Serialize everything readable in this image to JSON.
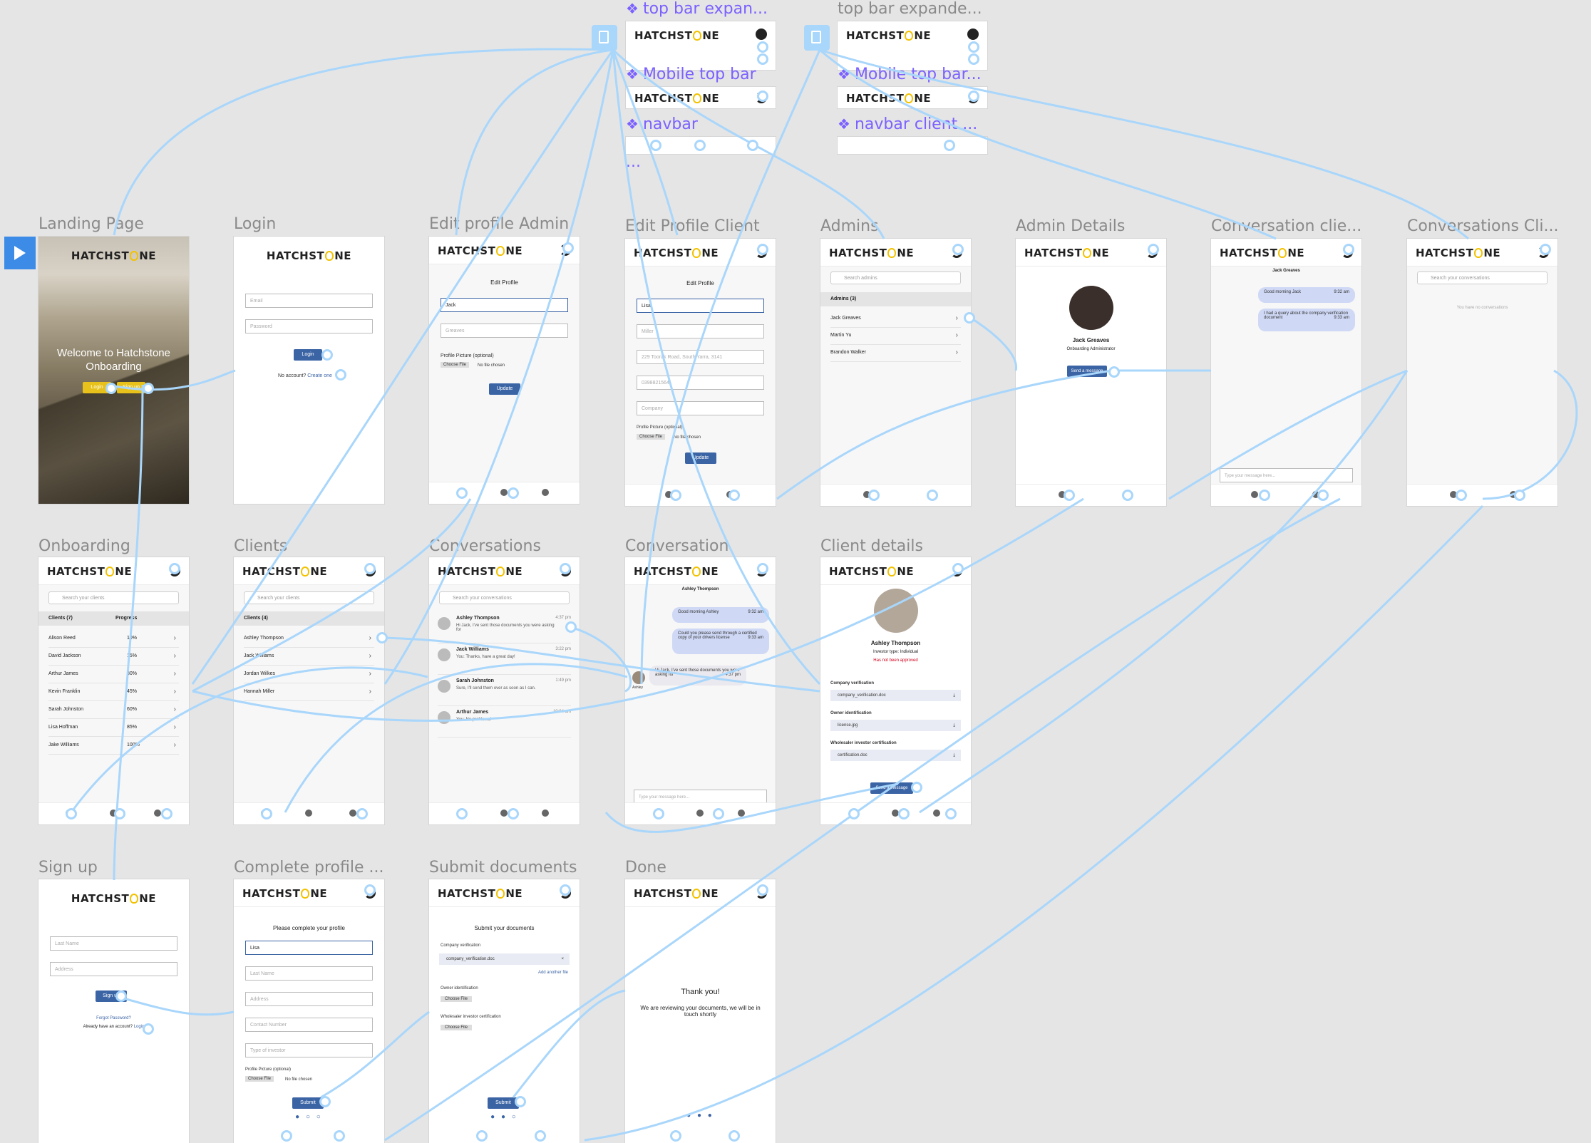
{
  "brand": {
    "logo_text_before": "HATCHST",
    "logo_text_after": "NE",
    "accent": "#3b64a5",
    "logo_yellow": "#f2c200",
    "connector": "#a9d6fb",
    "component_purple": "#7b61ff"
  },
  "components": {
    "top_bar_expanded_1": "top bar expan...",
    "top_bar_expanded_2": "top bar expande...",
    "mobile_top_bar_1": "Mobile top bar",
    "mobile_top_bar_2": "Mobile top bar...",
    "navbar": "navbar",
    "navbar_client": "navbar client ...",
    "more": "..."
  },
  "frames": {
    "landing": {
      "label": "Landing Page",
      "welcome": "Welcome to Hatchstone Onboarding",
      "login_btn": "Login",
      "signup_btn": "Sign up"
    },
    "login": {
      "label": "Login",
      "email_ph": "Email",
      "password_ph": "Password",
      "submit": "Login",
      "no_account": "No account?",
      "create": "Create one"
    },
    "edit_profile_admin": {
      "label": "Edit profile Admin",
      "heading": "Edit Profile",
      "first": "Jack",
      "last": "Greaves",
      "pic_label": "Profile Picture (optional)",
      "choose": "Choose File",
      "no_file": "No file chosen",
      "update": "Update"
    },
    "edit_profile_client": {
      "label": "Edit Profile Client",
      "heading": "Edit Profile",
      "first": "Lisa",
      "last": "Miller",
      "address": "229 Toorak Road, South Yarra, 3141",
      "phone": "0398821564",
      "type": "Company",
      "pic_label": "Profile Picture (optional)",
      "choose": "Choose File",
      "no_file": "No file chosen",
      "update": "Update"
    },
    "admins": {
      "label": "Admins",
      "search_ph": "Search admins",
      "section": "Admins (3)",
      "rows": [
        "Jack Greaves",
        "Martin Yu",
        "Brandon Walker"
      ]
    },
    "admin_details": {
      "label": "Admin Details",
      "name": "Jack Greaves",
      "role": "Onboarding Administrator",
      "send": "Send a message"
    },
    "conversation_client": {
      "label": "Conversation clie...",
      "with": "Jack Greaves",
      "b1": "Good morning Jack",
      "b1_time": "9:32 am",
      "b2": "I had a query about the company verification document",
      "b2_time": "9:33 am",
      "input_ph": "Type your message here..."
    },
    "conversations_client": {
      "label": "Conversations Cli...",
      "search_ph": "Search your conversations",
      "empty": "You have no conversations"
    },
    "onboarding": {
      "label": "Onboarding",
      "search_ph": "Search your clients",
      "col1": "Clients (7)",
      "col2": "Progress",
      "rows": [
        {
          "name": "Alison Reed",
          "pct": "10%"
        },
        {
          "name": "David Jackson",
          "pct": "15%"
        },
        {
          "name": "Arthur James",
          "pct": "30%"
        },
        {
          "name": "Kevin Franklin",
          "pct": "45%"
        },
        {
          "name": "Sarah Johnston",
          "pct": "60%"
        },
        {
          "name": "Lisa Hoffman",
          "pct": "85%"
        },
        {
          "name": "Jake Williams",
          "pct": "100%"
        }
      ]
    },
    "clients": {
      "label": "Clients",
      "search_ph": "Search your clients",
      "section": "Clients (4)",
      "rows": [
        "Ashley Thompson",
        "Jack Williams",
        "Jordan Wilkes",
        "Hannah Miller"
      ]
    },
    "conversations": {
      "label": "Conversations",
      "search_ph": "Search your conversations",
      "items": [
        {
          "name": "Ashley Thompson",
          "time": "4:37 pm",
          "msg": "Hi Jack, I've sent those documents you were asking for"
        },
        {
          "name": "Jack Williams",
          "time": "3:22 pm",
          "msg": "You: Thanks, have a great day!"
        },
        {
          "name": "Sarah Johnston",
          "time": "1:49 pm",
          "msg": "Sure, I'll send them over as soon as I can."
        },
        {
          "name": "Arthur James",
          "time": "10:04 am",
          "msg": "You: No problems!"
        }
      ]
    },
    "conversation": {
      "label": "Conversation",
      "with": "Ashley Thompson",
      "b1": "Good morning Ashley",
      "b1_time": "9:32 am",
      "b2": "Could you please send through a certified copy of your drivers license",
      "b2_time": "9:33 am",
      "b3": "Hi Jack, I've sent those documents you were asking for",
      "b3_time": "4:37 pm",
      "sender": "Ashley",
      "input_ph": "Type your message here..."
    },
    "client_details": {
      "label": "Client details",
      "name": "Ashley Thompson",
      "investor": "Investor type: Individual",
      "status": "Has not been approved",
      "sec1": "Company verification",
      "file1": "company_verification.doc",
      "sec2": "Owner identification",
      "file2": "license.jpg",
      "sec3": "Wholesaler investor certification",
      "file3": "certification.doc",
      "send": "Send a message"
    },
    "signup": {
      "label": "Sign up",
      "first_ph": "Last Name",
      "second_ph": "Address",
      "submit": "Sign up",
      "forgot": "Forgot Password?",
      "already": "Already have an account?",
      "login": "Login"
    },
    "complete_profile": {
      "label": "Complete profile ...",
      "heading": "Please complete your profile",
      "first": "Lisa",
      "f2": "Last Name",
      "f3": "Address",
      "f4": "Contact Number",
      "f5": "Type of investor",
      "pic_label": "Profile Picture (optional)",
      "choose": "Choose File",
      "no_file": "No file chosen",
      "submit": "Submit"
    },
    "submit_documents": {
      "label": "Submit documents",
      "heading": "Submit your documents",
      "sec1": "Company verification",
      "file1": "company_verification.doc",
      "add": "Add another file",
      "sec2": "Owner identification",
      "sec3": "Wholesaler investor certification",
      "choose": "Choose File",
      "submit": "Submit"
    },
    "done": {
      "label": "Done",
      "thanks": "Thank you!",
      "body": "We are reviewing your documents, we will be in touch shortly"
    }
  }
}
